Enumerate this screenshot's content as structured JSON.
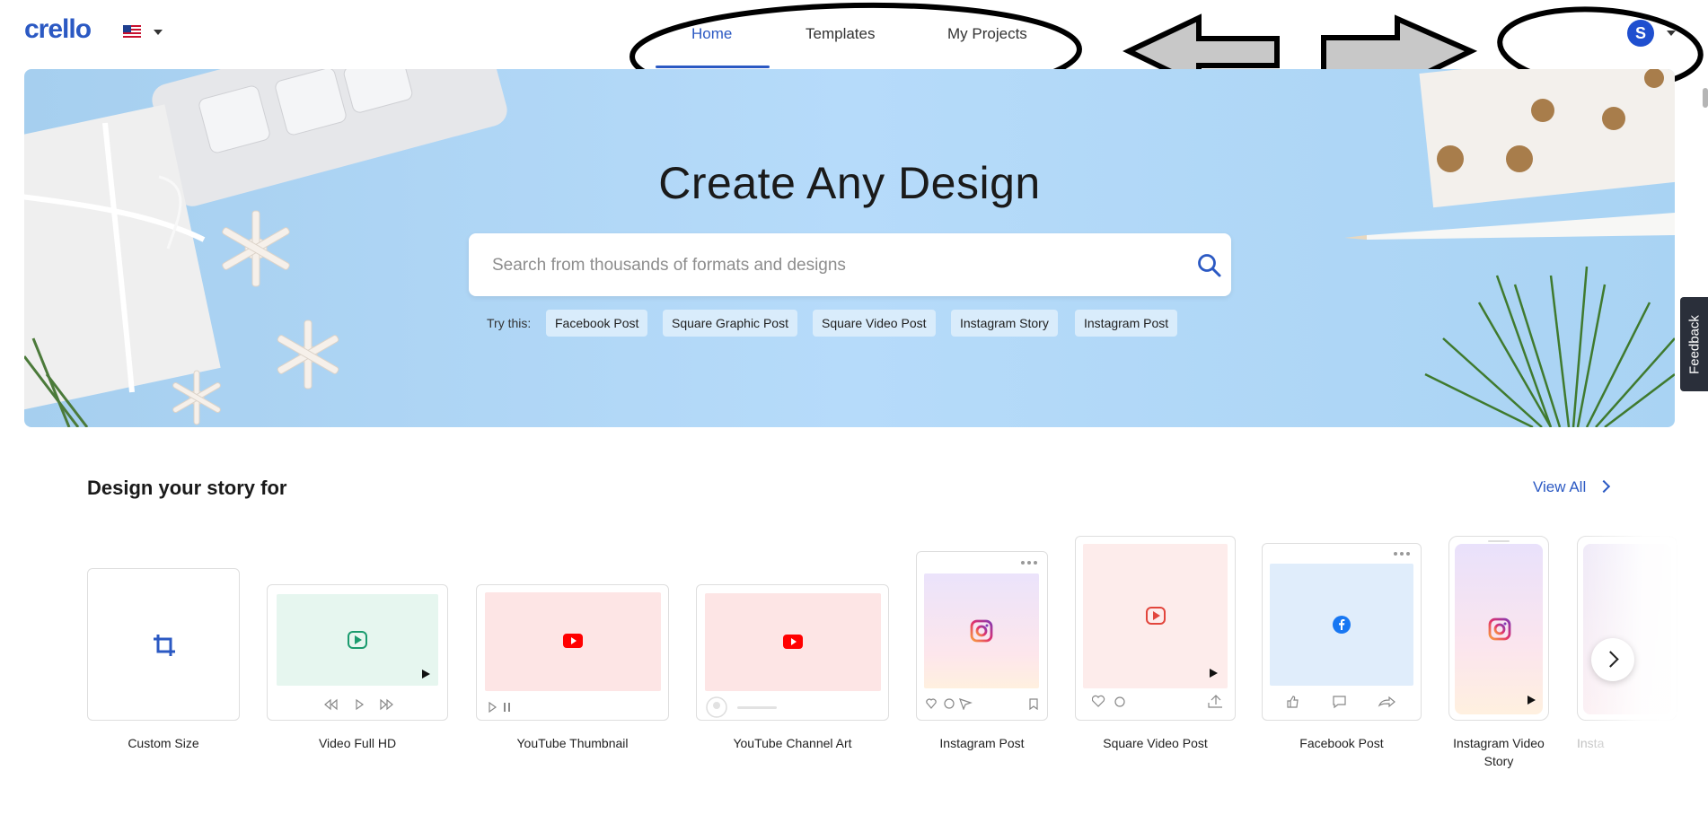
{
  "header": {
    "logo": "crello",
    "flag_icon": "us-flag-icon",
    "nav": [
      {
        "label": "Home",
        "active": true
      },
      {
        "label": "Templates",
        "active": false
      },
      {
        "label": "My Projects",
        "active": false
      }
    ],
    "avatar_initial": "S"
  },
  "hero": {
    "title": "Create Any Design",
    "search_placeholder": "Search from thousands of formats and designs",
    "try_label": "Try this:",
    "suggestions": [
      "Facebook Post",
      "Square Graphic Post",
      "Square Video Post",
      "Instagram Story",
      "Instagram Post"
    ]
  },
  "feedback": "Feedback",
  "section": {
    "title": "Design your story for",
    "view_all": "View All",
    "cards": [
      {
        "label": "Custom Size",
        "icon": "crop-icon"
      },
      {
        "label": "Video Full HD",
        "icon": "play-icon"
      },
      {
        "label": "YouTube Thumbnail",
        "icon": "youtube-icon"
      },
      {
        "label": "YouTube Channel Art",
        "icon": "youtube-icon"
      },
      {
        "label": "Instagram Post",
        "icon": "instagram-icon"
      },
      {
        "label": "Square Video Post",
        "icon": "play-icon"
      },
      {
        "label": "Facebook Post",
        "icon": "facebook-icon"
      },
      {
        "label": "Instagram Video Story",
        "icon": "instagram-icon"
      },
      {
        "label": "Insta",
        "icon": "instagram-icon"
      }
    ]
  },
  "colors": {
    "brand": "#2b59c3",
    "hero_bg": "#b6dbfa",
    "chip_bg": "#d9ecfb",
    "youtube_red": "#ff0000",
    "facebook_blue": "#1877f2",
    "video_green": "#1a9b6e"
  }
}
